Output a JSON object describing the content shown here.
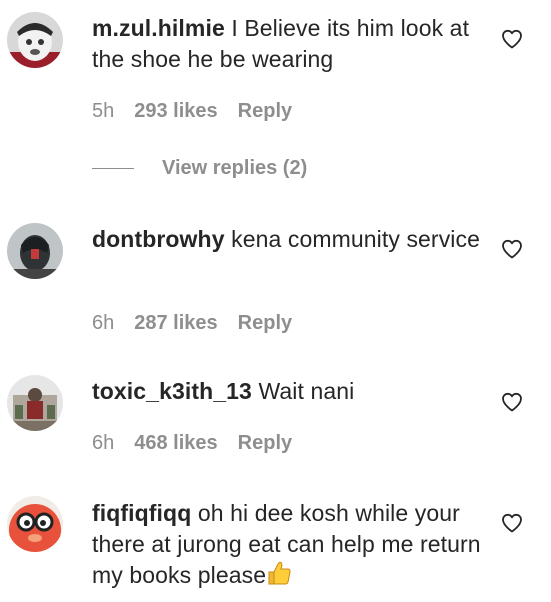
{
  "comments": [
    {
      "username": "m.zul.hilmie",
      "text": "I Believe its him look at the shoe he be wearing",
      "time": "5h",
      "likes": "293 likes",
      "reply_label": "Reply"
    },
    {
      "username": "dontbrowhy",
      "text": "kena community service",
      "time": "6h",
      "likes": "287 likes",
      "reply_label": "Reply"
    },
    {
      "username": "toxic_k3ith_13",
      "text": "Wait nani",
      "time": "6h",
      "likes": "468 likes",
      "reply_label": "Reply"
    },
    {
      "username": "fiqfiqfiqq",
      "text": "oh hi dee kosh while your there at jurong eat can help me return my books please",
      "emoji": "thumbs-up"
    }
  ],
  "view_replies_label": "View replies (2)",
  "icons": {
    "like": "heart-outline-icon"
  },
  "colors": {
    "text": "#262626",
    "secondary": "#8e8e8e"
  }
}
